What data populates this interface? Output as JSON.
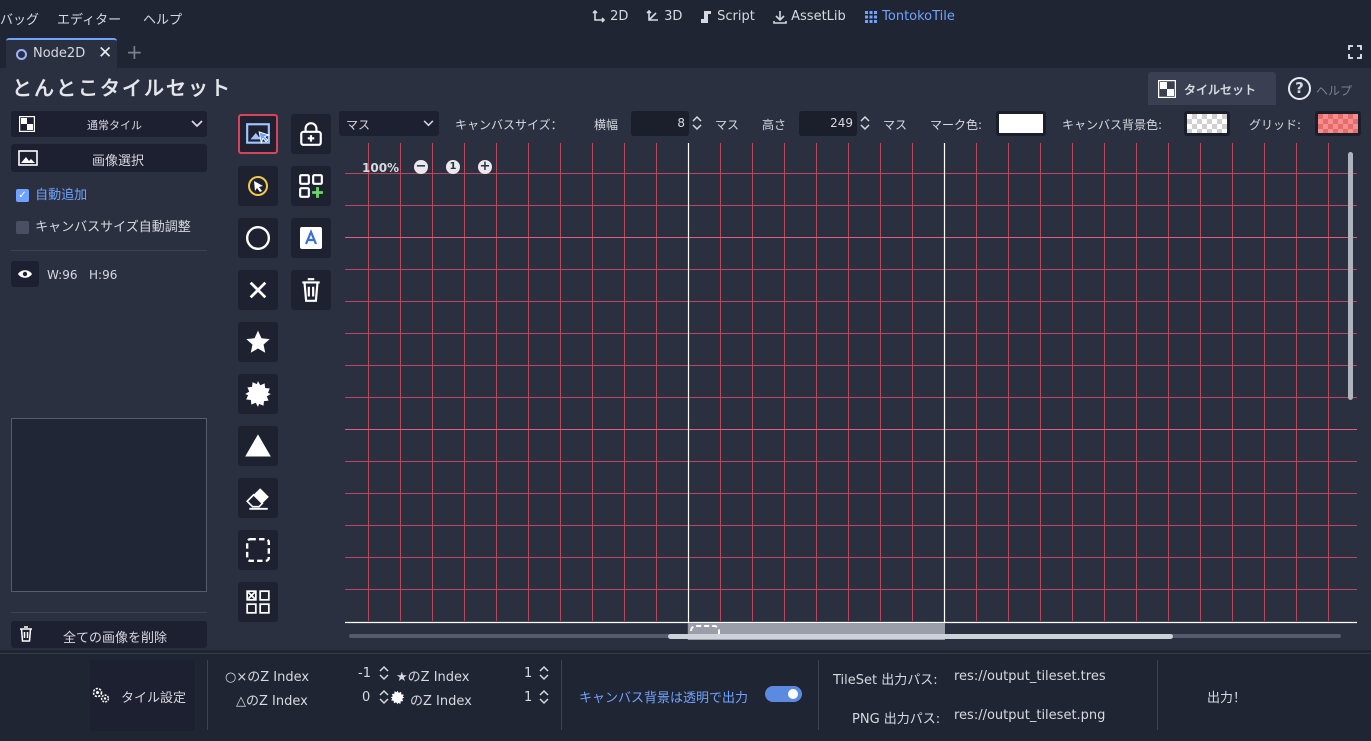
{
  "menu": {
    "items": [
      "バッグ",
      "エディター",
      "ヘルプ"
    ]
  },
  "workspaces": [
    {
      "label": "2D",
      "icon": "2d-icon",
      "active": false
    },
    {
      "label": "3D",
      "icon": "3d-icon",
      "active": false
    },
    {
      "label": "Script",
      "icon": "script-icon",
      "active": false
    },
    {
      "label": "AssetLib",
      "icon": "assetlib-icon",
      "active": false
    },
    {
      "label": "TontokoTile",
      "icon": "tontokotile-icon",
      "active": true
    }
  ],
  "scene_tab": {
    "label": "Node2D"
  },
  "plugin": {
    "title": "とんとこタイルセット",
    "tab_tileset": "タイルセット",
    "tab_help": "ヘルプ"
  },
  "left": {
    "tile_type": "通常タイル",
    "select_image": "画像選択",
    "auto_add": "自動追加",
    "auto_canvas": "キャンバスサイズ自動調整",
    "image_item": {
      "w": "W:96",
      "h": "H:96"
    },
    "delete_all": "全ての画像を削除"
  },
  "toolbar": {
    "unit": "マス",
    "canvas_size_label": "キャンバスサイズ：",
    "width_label": "横幅",
    "width_value": "8",
    "width_unit": "マス",
    "height_label": "高さ",
    "height_value": "249",
    "height_unit": "マス",
    "mark_color_label": "マーク色:",
    "bg_color_label": "キャンバス背景色:",
    "grid_label": "グリッド:",
    "colors": {
      "mark": "#ffffff",
      "grid": "#e86a6a",
      "grid_line": "#c8495a"
    }
  },
  "canvas": {
    "zoom": "100%",
    "reset": "1"
  },
  "bottom": {
    "tile_settings": "タイル設定",
    "z_circle_x_label": "○×のZ Index",
    "z_circle_x_value": "-1",
    "z_star_label": "★のZ Index",
    "z_star_value": "1",
    "z_triangle_label": "△のZ Index",
    "z_triangle_value": "0",
    "z_burst_label": "のZ Index",
    "z_burst_value": "1",
    "transparent_bg": "キャンバス背景は透明で出力",
    "tileset_path_label": "TileSet 出力パス:",
    "tileset_path": "res://output_tileset.tres",
    "png_path_label": "PNG 出力パス:",
    "png_path": "res://output_tileset.png",
    "export": "出力！"
  }
}
